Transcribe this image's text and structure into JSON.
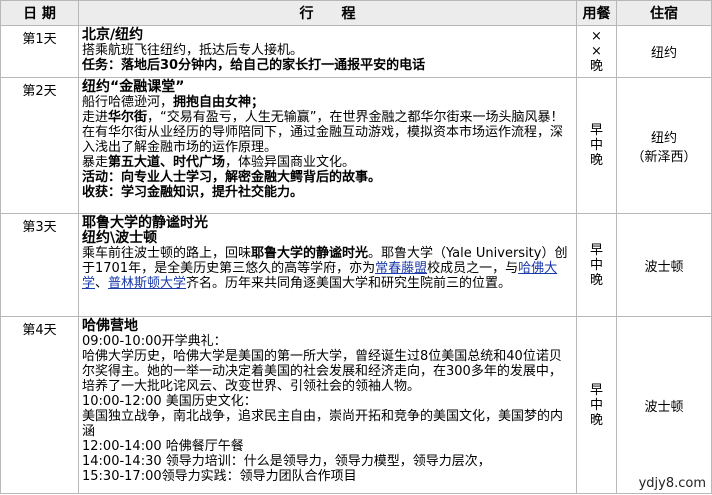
{
  "header": {
    "date": "日 期",
    "itinerary": "行　　程",
    "meal": "用餐",
    "hotel": "住宿"
  },
  "rows": [
    {
      "day": "第1天",
      "title": "北京/纽约",
      "l1": "搭乘航班飞往纽约，抵达后专人接机。",
      "l2": "任务：落地后30分钟内，给自己的家长打一通报平安的电话",
      "meals": [
        "×",
        "×",
        "晚"
      ],
      "hotel": "纽约"
    },
    {
      "day": "第2天",
      "title": "纽约“金融课堂”",
      "l1a": "船行哈德逊河，",
      "l1b": "拥抱自由女神；",
      "l2a": "走进",
      "l2b": "华尔街",
      "l2c": "，“交易有盈亏，人生无输赢”，在世界金融之都华尔街来一场头脑风暴！在有华尔街从业经历的导师陪同下，通过金融互动游戏，模拟资本市场运作流程，深入浅出了解金融市场的运作原理。",
      "l3a": "暴走",
      "l3b": "第五大道、时代广场",
      "l3c": "，体验异国商业文化。",
      "l4": "活动：向专业人士学习，解密金融大鳄背后的故事。",
      "l5": "收获：学习金融知识，提升社交能力。",
      "meals": [
        "早",
        "中",
        "晚"
      ],
      "hotel": "纽约",
      "hotel2": "（新泽西）"
    },
    {
      "day": "第3天",
      "title": "耶鲁大学的静谧时光",
      "subtitle": "纽约\\波士顿",
      "p1": "乘车前往波士顿的路上，回味",
      "p2": "耶鲁大学的静谧时光",
      "p3": "。耶鲁大学（Yale University）创于1701年，是全美历史第三悠久的高等学府，亦为",
      "link1": "常春藤盟",
      "p4": "校成员之一，与",
      "link2": "哈佛大学",
      "p5": "、",
      "link3": "普林斯顿大学",
      "p6": "齐名。历年来共同角逐美国大学和研究生院前三的位置。",
      "meals": [
        "早",
        "中",
        "晚"
      ],
      "hotel": "波士顿"
    },
    {
      "day": "第4天",
      "title": "哈佛营地",
      "lines": [
        "09:00-10:00开学典礼：",
        "哈佛大学历史，哈佛大学是美国的第一所大学，曾经诞生过8位美国总统和40位诺贝尔奖得主。她的一举一动决定着美国的社会发展和经济走向，在300多年的发展中，培养了一大批叱诧风云、改变世界、引领社会的领袖人物。",
        "10:00-12:00 美国历史文化：",
        "美国独立战争，南北战争，追求民主自由，崇尚开拓和竞争的美国文化，美国梦的内涵",
        "12:00-14:00 哈佛餐厅午餐",
        "14:00-14:30 领导力培训：什么是领导力，领导力模型，领导力层次，",
        "15:30-17:00领导力实践：领导力团队合作项目"
      ],
      "meals": [
        "早",
        "中",
        "晚"
      ],
      "hotel": "波士顿"
    }
  ],
  "watermark": "ydjy8.com",
  "colors": {
    "header_bg": "#ececec",
    "border": "#b8b8b8",
    "link": "#1a3aa8"
  }
}
